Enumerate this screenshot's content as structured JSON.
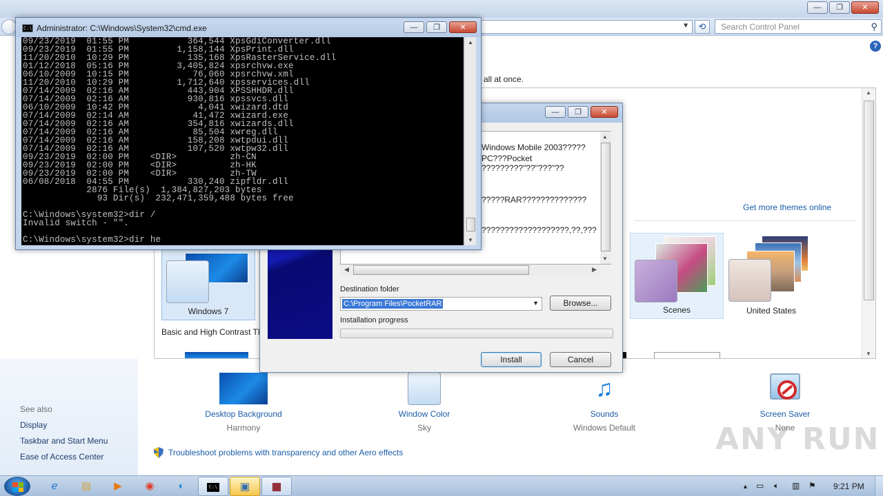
{
  "control_panel": {
    "search_placeholder": "Search Control Panel",
    "help_label": "?",
    "description_fragment": "all at once.",
    "get_more_themes": "Get more themes online",
    "themes": [
      {
        "label": "Windows 7"
      },
      {
        "label": "Scenes"
      },
      {
        "label": "United States"
      }
    ],
    "basic_high_contrast": "Basic and High Contrast Th",
    "settings": {
      "desktop_background": {
        "link": "Desktop Background",
        "value": "Harmony"
      },
      "window_color": {
        "link": "Window Color",
        "value": "Sky"
      },
      "sounds": {
        "link": "Sounds",
        "value": "Windows Default"
      },
      "screen_saver": {
        "link": "Screen Saver",
        "value": "None"
      }
    },
    "see_also": {
      "heading": "See also",
      "items": [
        "Display",
        "Taskbar and Start Menu",
        "Ease of Access Center"
      ]
    },
    "troubleshoot": "Troubleshoot problems with transparency and other Aero effects",
    "window_buttons": {
      "minimize": "—",
      "maximize": "❐",
      "close": "✕"
    }
  },
  "installer": {
    "text_lines": [
      "Windows Mobile 2003?????",
      "PC???Pocket",
      "?????????\"??\"???\"??",
      "",
      "?????RAR??????????????",
      "",
      "???????????????????,??,???"
    ],
    "destination_label": "Destination folder",
    "destination_value": "C:\\Program Files\\PocketRAR",
    "browse_label": "Browse...",
    "progress_label": "Installation progress",
    "progress_fraction": 0,
    "install_label": "Install",
    "cancel_label": "Cancel",
    "window_buttons": {
      "minimize": "—",
      "maximize": "❐",
      "close": "✕"
    }
  },
  "cmd": {
    "title": "Administrator: C:\\Windows\\System32\\cmd.exe",
    "icon_text": "C:\\",
    "lines": [
      "09/23/2019  01:55 PM           364,544 XpsGdiConverter.dll",
      "09/23/2019  01:55 PM         1,158,144 XpsPrint.dll",
      "11/20/2010  10:29 PM           135,168 XpsRasterService.dll",
      "01/12/2018  05:16 PM         3,405,824 xpsrchvw.exe",
      "06/10/2009  10:15 PM            76,060 xpsrchvw.xml",
      "11/20/2010  10:29 PM         1,712,640 xpsservices.dll",
      "07/14/2009  02:16 AM           443,904 XPSSHHDR.dll",
      "07/14/2009  02:16 AM           930,816 xpssvcs.dll",
      "06/10/2009  10:42 PM             4,041 xwizard.dtd",
      "07/14/2009  02:14 AM            41,472 xwizard.exe",
      "07/14/2009  02:16 AM           354,816 xwizards.dll",
      "07/14/2009  02:16 AM            85,504 xwreg.dll",
      "07/14/2009  02:16 AM           158,208 xwtpdui.dll",
      "07/14/2009  02:16 AM           107,520 xwtpw32.dll",
      "09/23/2019  02:00 PM    <DIR>          zh-CN",
      "09/23/2019  02:00 PM    <DIR>          zh-HK",
      "09/23/2019  02:00 PM    <DIR>          zh-TW",
      "06/08/2018  04:55 PM           330,240 zipfldr.dll",
      "            2876 File(s)  1,384,827,203 bytes",
      "              93 Dir(s)  232,471,359,488 bytes free",
      "",
      "C:\\Windows\\system32>dir /",
      "Invalid switch - \"\".",
      "",
      "C:\\Windows\\system32>dir he"
    ],
    "window_buttons": {
      "minimize": "—",
      "maximize": "❐",
      "close": "✕"
    }
  },
  "taskbar": {
    "clock": "9:21 PM",
    "cmd_icon_text": "C:\\",
    "icons": [
      "start-icon",
      "internet-explorer-icon",
      "explorer-icon",
      "media-player-icon",
      "chrome-icon",
      "edge-icon",
      "cmd-icon",
      "control-panel-icon",
      "winrar-icon"
    ]
  },
  "watermark": "ANY RUN",
  "colors": {
    "link": "#1a5ca8",
    "cmd_text": "#c0c0c0",
    "selection": "#3b78d6",
    "rar_banner": "#0a0b8a"
  }
}
